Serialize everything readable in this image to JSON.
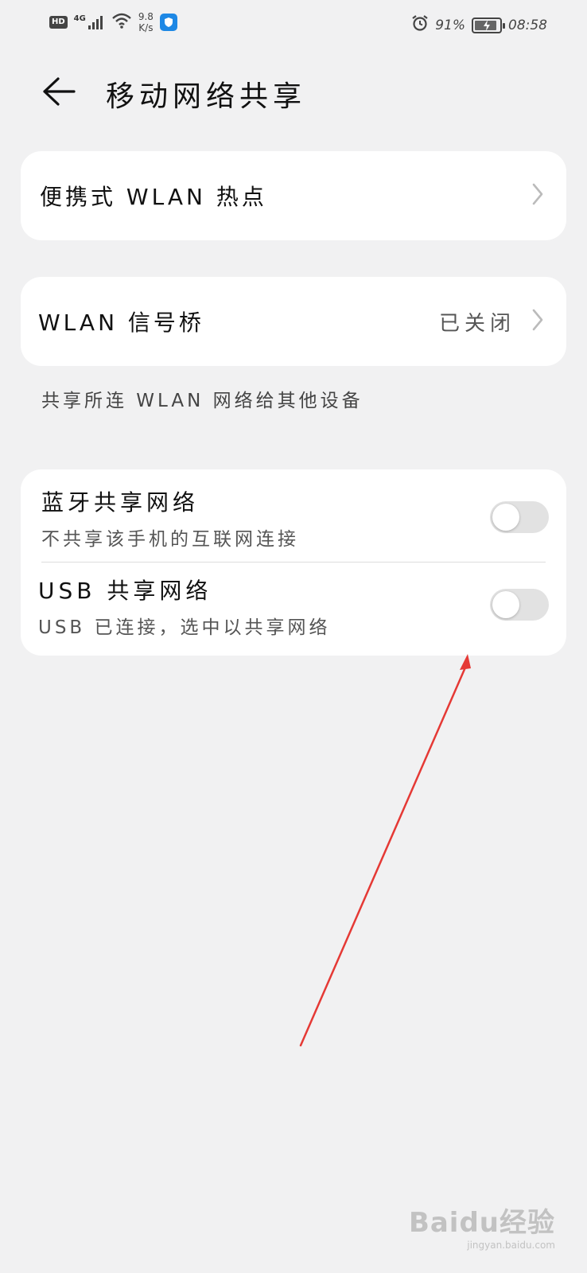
{
  "status_bar": {
    "hd": "HD",
    "network": "4G",
    "speed_value": "9.8",
    "speed_unit": "K/s",
    "battery_percent": "91%",
    "battery_level": 0.91,
    "time": "08:58"
  },
  "header": {
    "title": "移动网络共享"
  },
  "hotspot": {
    "label": "便携式 WLAN 热点"
  },
  "bridge": {
    "label": "WLAN 信号桥",
    "status": "已关闭",
    "hint": "共享所连 WLAN 网络给其他设备"
  },
  "tethering": {
    "bluetooth": {
      "title": "蓝牙共享网络",
      "subtitle": "不共享该手机的互联网连接",
      "enabled": false
    },
    "usb": {
      "title": "USB 共享网络",
      "subtitle": "USB 已连接，选中以共享网络",
      "enabled": false
    }
  },
  "annotation": {
    "arrow_color": "#e53935"
  },
  "watermark": {
    "main": "Baidu经验",
    "sub": "jingyan.baidu.com"
  }
}
